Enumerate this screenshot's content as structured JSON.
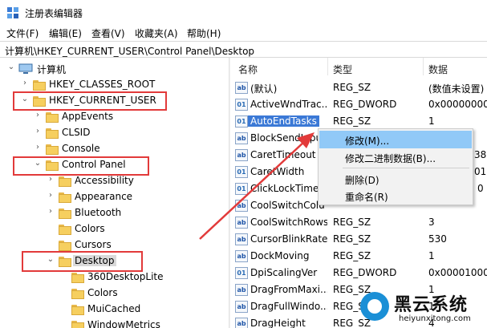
{
  "window": {
    "title": "注册表编辑器",
    "icon": "regedit-icon"
  },
  "menu": [
    "文件(F)",
    "编辑(E)",
    "查看(V)",
    "收藏夹(A)",
    "帮助(H)"
  ],
  "address": "计算机\\HKEY_CURRENT_USER\\Control Panel\\Desktop",
  "tree": {
    "root": "计算机",
    "items": [
      "HKEY_CLASSES_ROOT",
      "HKEY_CURRENT_USER",
      "AppEvents",
      "CLSID",
      "Console",
      "Control Panel",
      "Accessibility",
      "Appearance",
      "Bluetooth",
      "Colors",
      "Cursors",
      "Desktop",
      "360DesktopLite",
      "Colors",
      "MuiCached",
      "WindowMetrics"
    ]
  },
  "list": {
    "headers": {
      "name": "名称",
      "type": "类型",
      "data": "数据"
    },
    "rows": [
      {
        "name": "(默认)",
        "type": "REG_SZ",
        "data": "(数值未设置)"
      },
      {
        "name": "ActiveWndTrac...",
        "type": "REG_DWORD",
        "data": "0x00000000"
      },
      {
        "name": "AutoEndTasks",
        "type": "REG_SZ",
        "data": "1"
      },
      {
        "name": "BlockSendInpu",
        "type": "",
        "data": ""
      },
      {
        "name": "CaretTimeout",
        "type": "",
        "data": "38"
      },
      {
        "name": "CaretWidth",
        "type": "",
        "data": "01"
      },
      {
        "name": "ClickLockTime",
        "type": "",
        "data": "0"
      },
      {
        "name": "CoolSwitchColu",
        "type": "",
        "data": ""
      },
      {
        "name": "CoolSwitchRows",
        "type": "REG_SZ",
        "data": "3"
      },
      {
        "name": "CursorBlinkRate",
        "type": "REG_SZ",
        "data": "530"
      },
      {
        "name": "DockMoving",
        "type": "REG_SZ",
        "data": "1"
      },
      {
        "name": "DpiScalingVer",
        "type": "REG_DWORD",
        "data": "0x00001000"
      },
      {
        "name": "DragFromMaxi...",
        "type": "REG_SZ",
        "data": "1"
      },
      {
        "name": "DragFullWindo...",
        "type": "REG_SZ",
        "data": "1"
      },
      {
        "name": "DragHeight",
        "type": "REG_SZ",
        "data": "4"
      }
    ]
  },
  "context_menu": [
    "修改(M)...",
    "修改二进制数据(B)...",
    "删除(D)",
    "重命名(R)"
  ],
  "watermark": {
    "title": "黑云系统",
    "subtitle": "heiyunxitong.com"
  },
  "colors": {
    "highlight_box": "#e23a3a",
    "arrow": "#e23a3a",
    "selection": "#3b79d6",
    "menu_hover": "#91c9f7"
  }
}
